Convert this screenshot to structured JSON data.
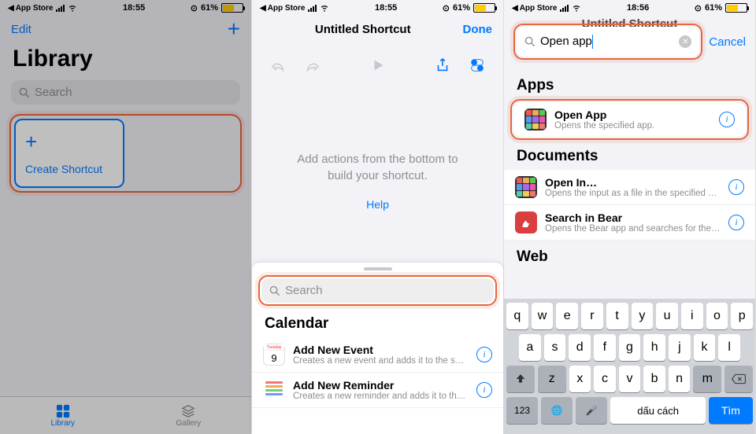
{
  "status": {
    "app": "App Store",
    "time1": "18:55",
    "time2": "18:55",
    "time3": "18:56",
    "battery": "61%"
  },
  "panel1": {
    "edit": "Edit",
    "header": "Library",
    "search_ph": "Search",
    "tile": {
      "label": "Create Shortcut"
    },
    "tabs": {
      "library": "Library",
      "gallery": "Gallery"
    }
  },
  "panel2": {
    "title": "Untitled Shortcut",
    "done": "Done",
    "hint": "Add actions from the bottom to build your shortcut.",
    "help": "Help",
    "search_ph": "Search",
    "section": "Calendar",
    "rows": [
      {
        "title": "Add New Event",
        "sub": "Creates a new event and adds it to the sel…"
      },
      {
        "title": "Add New Reminder",
        "sub": "Creates a new reminder and adds it to the…"
      }
    ]
  },
  "panel3": {
    "title_behind": "Untitled Shortcut",
    "search_value": "Open app",
    "cancel": "Cancel",
    "sections": {
      "apps": "Apps",
      "documents": "Documents",
      "web": "Web"
    },
    "apps_rows": [
      {
        "title": "Open App",
        "sub": "Opens the specified app."
      }
    ],
    "doc_rows": [
      {
        "title": "Open In…",
        "sub": "Opens the input as a file in the specified a…"
      },
      {
        "title": "Search in Bear",
        "sub": "Opens the Bear app and searches for the s…"
      }
    ],
    "keyboard": {
      "r1": [
        "q",
        "w",
        "e",
        "r",
        "t",
        "y",
        "u",
        "i",
        "o",
        "p"
      ],
      "r2": [
        "a",
        "s",
        "d",
        "f",
        "g",
        "h",
        "j",
        "k",
        "l"
      ],
      "r3": [
        "z",
        "x",
        "c",
        "v",
        "b",
        "n",
        "m"
      ],
      "num": "123",
      "space": "dấu cách",
      "enter": "Tìm"
    }
  }
}
